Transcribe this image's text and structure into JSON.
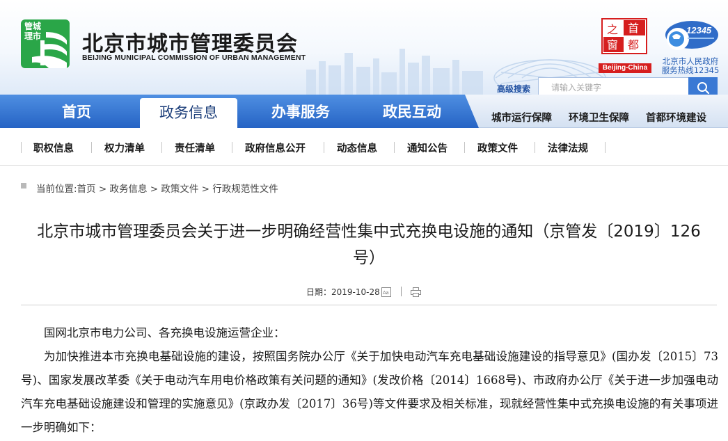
{
  "header": {
    "logo_badge": [
      "管城",
      "理市"
    ],
    "site_title": "北京市城市管理委员会",
    "site_subtitle": "BEIJING MUNICIPAL COMMISSION OF URBAN MANAGEMENT",
    "seal_chars": [
      "之",
      "首",
      "窗",
      "都"
    ],
    "seal_caption": "Beijing-China",
    "hotline_number": "12345",
    "hotline_line1": "北京市人民政府",
    "hotline_line2": "服务热线12345",
    "advanced_search_label": "高级搜索",
    "search_placeholder": "请输入关键字"
  },
  "main_nav": {
    "items": [
      {
        "label": "首页",
        "active": false
      },
      {
        "label": "政务信息",
        "active": true
      },
      {
        "label": "办事服务",
        "active": false
      },
      {
        "label": "政民互动",
        "active": false
      }
    ],
    "side_links": [
      "城市运行保障",
      "环境卫生保障",
      "首都环境建设"
    ]
  },
  "sub_nav": {
    "items": [
      "职权信息",
      "权力清单",
      "责任清单",
      "政府信息公开",
      "动态信息",
      "通知公告",
      "政策文件",
      "法律法规"
    ]
  },
  "breadcrumb": {
    "text": "当前位置:首页 > 政务信息 > 政策文件 > 行政规范性文件"
  },
  "article": {
    "title_line1": "北京市城市管理委员会关于进一步明确经营性集中式充换电设施的通知（京管发〔2019〕126",
    "title_line2": "号）",
    "date_label": "日期：",
    "date_value": "2019-10-28",
    "salutation": "国网北京市电力公司、各充换电设施运营企业：",
    "body": "为加快推进本市充换电基础设施的建设，按照国务院办公厅《关于加快电动汽车充电基础设施建设的指导意见》(国办发〔2015〕73号)、国家发展改革委《关于电动汽车用电价格政策有关问题的通知》(发改价格〔2014〕1668号)、市政府办公厅《关于进一步加强电动汽车充电基础设施建设和管理的实施意见》(京政办发〔2017〕36号)等文件要求及相关标准，现就经营性集中式充换电设施的有关事项进一步明确如下："
  },
  "colors": {
    "nav_blue": "#2f72cf",
    "logo_green": "#2aa648",
    "seal_red": "#d61e1e",
    "link_blue": "#1f4fa0"
  }
}
